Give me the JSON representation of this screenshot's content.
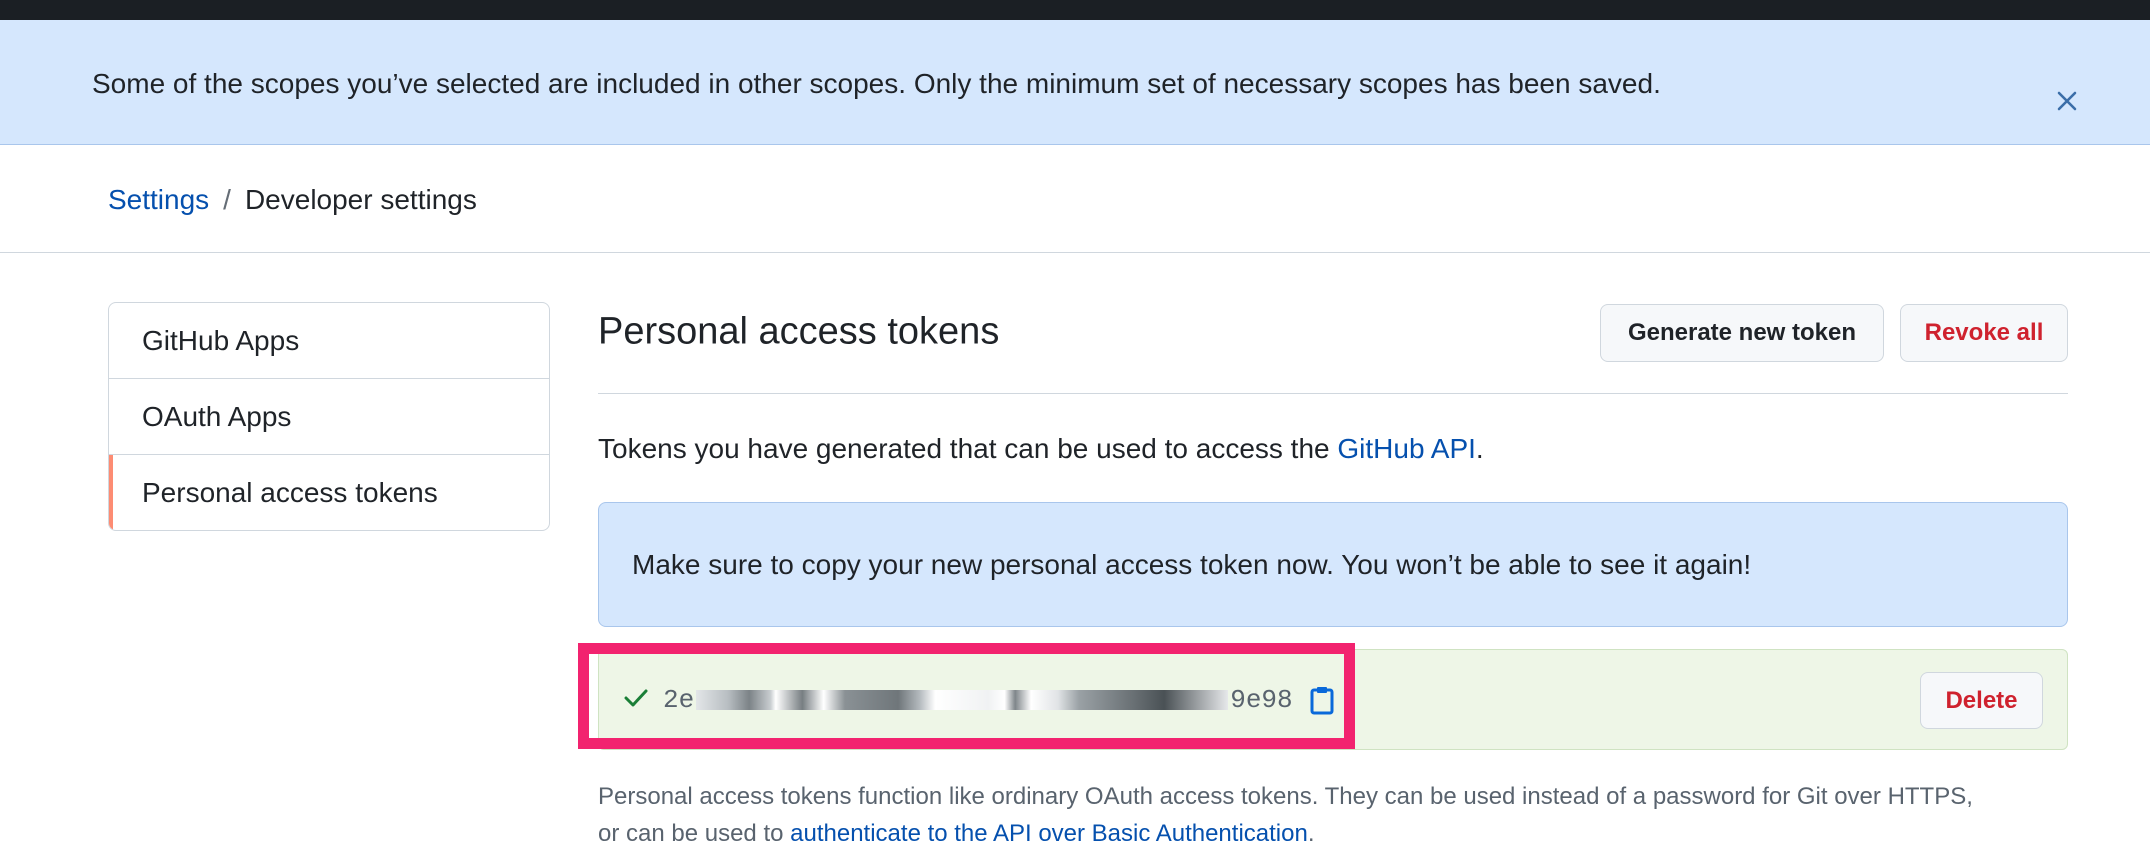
{
  "flash": {
    "message": "Some of the scopes you’ve selected are included in other scopes. Only the minimum set of necessary scopes has been saved.",
    "close_icon": "close-icon"
  },
  "breadcrumb": {
    "root": "Settings",
    "separator": "/",
    "current": "Developer settings"
  },
  "sidebar": {
    "items": [
      {
        "label": "GitHub Apps",
        "selected": false
      },
      {
        "label": "OAuth Apps",
        "selected": false
      },
      {
        "label": "Personal access tokens",
        "selected": true
      }
    ]
  },
  "main": {
    "title": "Personal access tokens",
    "generate_label": "Generate new token",
    "revoke_label": "Revoke all",
    "intro_text": "Tokens you have generated that can be used to access the ",
    "intro_link": "GitHub API",
    "intro_end": ".",
    "notice": "Make sure to copy your new personal access token now. You won’t be able to see it again!",
    "token": {
      "prefix": "2e",
      "suffix": "9e98",
      "status_icon": "check-icon",
      "copy_icon": "clipboard-icon"
    },
    "delete_label": "Delete",
    "footnote_line1": "Personal access tokens function like ordinary OAuth access tokens. They can be used instead of a password for Git over HTTPS,",
    "footnote_prefix": "or can be used to ",
    "footnote_link": "authenticate to the API over Basic Authentication",
    "footnote_end": "."
  },
  "colors": {
    "banner_bg": "#d5e7fd",
    "selected_indicator": "#fd8c73",
    "danger": "#cf222e",
    "link": "#0550ae",
    "success": "#1a7f37",
    "highlight": "#f2236f"
  }
}
